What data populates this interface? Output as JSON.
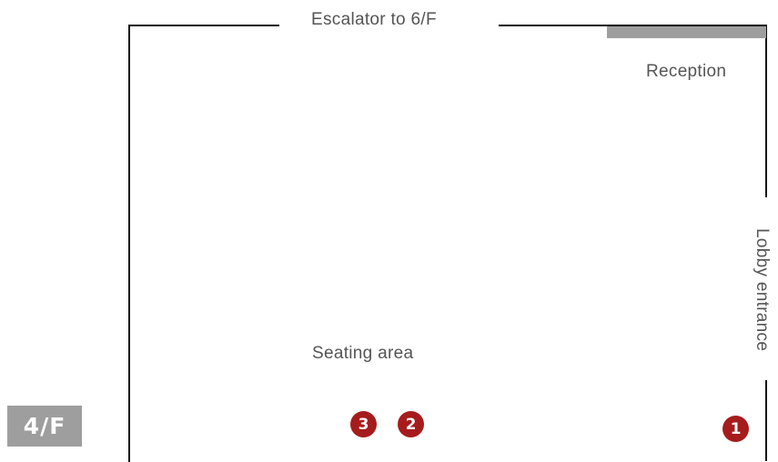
{
  "floor_label": "4/F",
  "labels": {
    "escalator": "Escalator to 6/F",
    "reception": "Reception",
    "lobby_entrance": "Lobby entrance",
    "seating_area": "Seating area"
  },
  "markers": [
    {
      "number": "1"
    },
    {
      "number": "2"
    },
    {
      "number": "3"
    }
  ],
  "colors": {
    "marker": "#a61c1c",
    "badge": "#9e9e9e",
    "reception_counter": "#9e9e9e",
    "walls": "#111111",
    "label_text": "#555555"
  }
}
